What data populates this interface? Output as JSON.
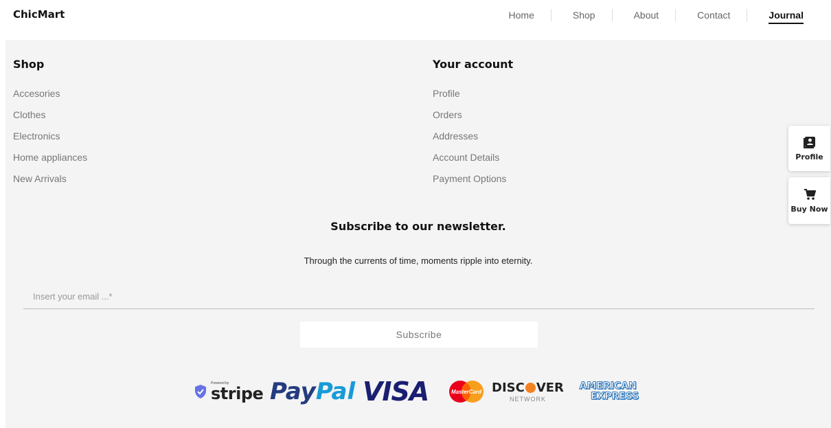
{
  "header": {
    "logo": "ChicMart",
    "nav": [
      "Home",
      "Shop",
      "About",
      "Contact",
      "Journal"
    ],
    "active": "Journal"
  },
  "footer": {
    "shop": {
      "title": "Shop",
      "items": [
        "Accesories",
        "Clothes",
        "Electronics",
        "Home appliances",
        "New Arrivals"
      ]
    },
    "account": {
      "title": "Your account",
      "items": [
        "Profile",
        "Orders",
        "Addresses",
        "Account Details",
        "Payment Options"
      ]
    },
    "newsletter": {
      "title": "Subscribe to our newsletter.",
      "subtitle": "Through the currents of time, moments ripple into eternity.",
      "email_placeholder": "Insert your email ...*",
      "button": "Subscribe"
    },
    "payments": {
      "stripe_small": "Powered by",
      "stripe": "stripe",
      "paypal_a": "Pay",
      "paypal_b": "Pal",
      "visa": "VISA",
      "mastercard": "MasterCard",
      "discover_a": "DISC",
      "discover_b": "VER",
      "discover_network": "NETWORK",
      "amex_a": "AMERICAN",
      "amex_b": "EXPRESS"
    }
  },
  "side": {
    "profile": "Profile",
    "buy": "Buy Now"
  },
  "colors": {
    "footer_bg": "#f4f4f4",
    "paypal_dark": "#253b80",
    "paypal_light": "#179bd7",
    "visa": "#1a1f71",
    "discover_orange": "#f58220"
  }
}
